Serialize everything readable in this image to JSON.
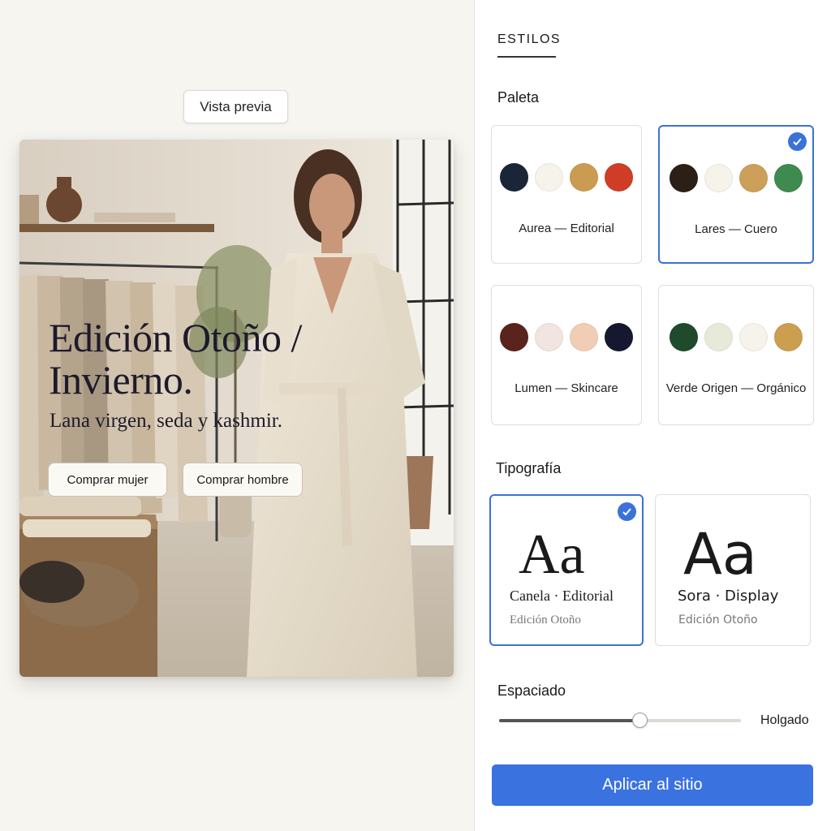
{
  "preview": {
    "chip_label": "Vista previa",
    "hero": {
      "title": "Edición Otoño / Invierno.",
      "subtitle": "Lana virgen, seda y kashmir.",
      "buttons": [
        "Comprar mujer",
        "Comprar hombre"
      ]
    }
  },
  "panel": {
    "title": "ESTILOS",
    "palette_label": "Paleta",
    "palettes": [
      {
        "name": "Aurea — Editorial",
        "colors": [
          "#1b2538",
          "#f6f3ea",
          "#cc9b52",
          "#cf3d26"
        ],
        "selected": false
      },
      {
        "name": "Lares — Cuero",
        "colors": [
          "#2b1f16",
          "#f6f3ea",
          "#cc9f5a",
          "#3f8a4e"
        ],
        "selected": true
      },
      {
        "name": "Lumen — Skincare",
        "colors": [
          "#5a241c",
          "#f2e4e0",
          "#f2cdb5",
          "#15182e"
        ],
        "selected": false
      },
      {
        "name": "Verde Origen — Orgánico",
        "colors": [
          "#1f4a2b",
          "#e7ead9",
          "#f6f3ea",
          "#cc9f50"
        ],
        "selected": false
      }
    ],
    "typography_label": "Tipografía",
    "typefaces": [
      {
        "sample": "Aa",
        "name": "Canela · Editorial",
        "preview": "Edición Otoño",
        "selected": true
      },
      {
        "sample": "Aa",
        "name": "Sora · Display",
        "preview": "Edición Otoño",
        "selected": false
      }
    ],
    "spacing_label": "Espaciado",
    "spacing_value_label": "Holgado",
    "spacing_level": 0.58,
    "apply_label": "Aplicar al sitio"
  },
  "colors": {
    "accent": "#3a72e0",
    "selected_border": "#3a72d8"
  }
}
